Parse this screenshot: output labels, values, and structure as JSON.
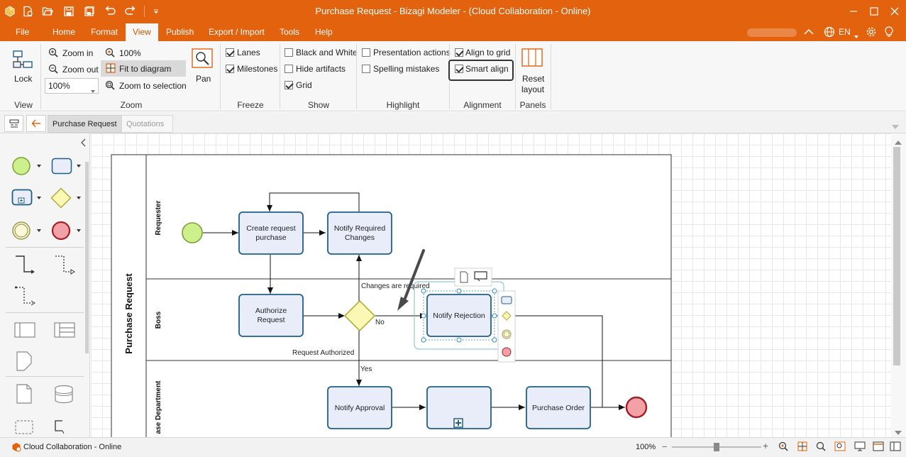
{
  "window": {
    "title": "Purchase Request - Bizagi Modeler - (Cloud Collaboration - Online)",
    "quick_access_icons": [
      "app-logo-icon",
      "new-file-icon",
      "open-folder-icon",
      "save-icon",
      "save-as-icon",
      "undo-icon",
      "redo-icon",
      "customize-icon"
    ]
  },
  "menu": {
    "items": [
      "File",
      "Home",
      "Format",
      "View",
      "Publish",
      "Export / Import",
      "Tools",
      "Help"
    ],
    "active": "View",
    "language": "EN"
  },
  "ribbon": {
    "view_group": {
      "lock_label": "Lock",
      "label": "View"
    },
    "zoom_group": {
      "zoom_in": "Zoom in",
      "zoom_out": "Zoom out",
      "zoom_value": "100%",
      "zoom_100": "100%",
      "fit_to_diagram": "Fit to diagram",
      "zoom_to_selection": "Zoom to selection",
      "pan": "Pan",
      "label": "Zoom"
    },
    "freeze_group": {
      "lanes": "Lanes",
      "milestones": "Milestones",
      "label": "Freeze",
      "lanes_checked": true,
      "milestones_checked": true
    },
    "show_group": {
      "black_and_white": "Black and White",
      "hide_artifacts": "Hide artifacts",
      "grid": "Grid",
      "label": "Show",
      "black_and_white_checked": false,
      "hide_artifacts_checked": false,
      "grid_checked": true
    },
    "highlight_group": {
      "presentation_actions": "Presentation actions",
      "spelling_mistakes": "Spelling mistakes",
      "label": "Highlight",
      "presentation_actions_checked": false,
      "spelling_mistakes_checked": false
    },
    "alignment_group": {
      "align_to_grid": "Align to grid",
      "smart_align": "Smart align",
      "label": "Alignment",
      "align_to_grid_checked": true,
      "smart_align_checked": true
    },
    "panels_group": {
      "reset_layout_line1": "Reset",
      "reset_layout_line2": "layout",
      "label": "Panels"
    }
  },
  "tabs": {
    "items": [
      "Purchase Request",
      "Quotations"
    ],
    "active": "Purchase Request"
  },
  "diagram": {
    "pool": "Purchase Request",
    "lanes": [
      "Requester",
      "Boss",
      "ase Department"
    ],
    "tasks": {
      "create_request_l1": "Create request",
      "create_request_l2": "purchase",
      "notify_changes_l1": "Notify Required",
      "notify_changes_l2": "Changes",
      "authorize_l1": "Authorize",
      "authorize_l2": "Request",
      "notify_rejection": "Notify Rejection",
      "notify_approval": "Notify Approval",
      "subprocess": "",
      "purchase_order": "Purchase Order"
    },
    "flow_labels": {
      "changes_required": "Changes are required",
      "no": "No",
      "request_authorized": "Request Authorized",
      "yes": "Yes"
    },
    "colors": {
      "task_fill": "#e8edf9",
      "task_stroke": "#1f5f8b",
      "start_fill": "#cdf08c",
      "end_fill": "#f2a2a6",
      "gateway_fill": "#fbf7b5",
      "accent": "#e2620e"
    }
  },
  "status": {
    "connection": "Cloud Collaboration - Online",
    "zoom": "100%",
    "zoom_level_fraction": 0.5
  }
}
